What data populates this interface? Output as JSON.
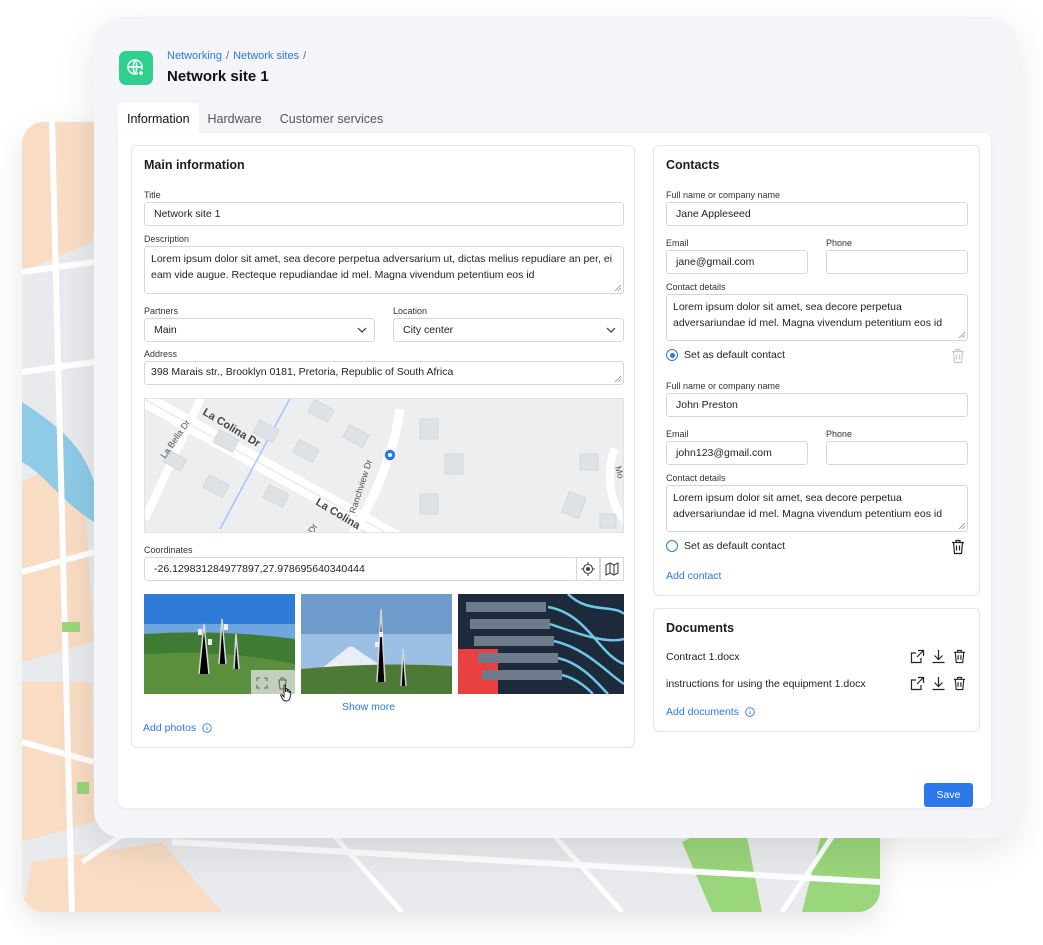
{
  "breadcrumb": {
    "item1": "Networking",
    "item2": "Network sites",
    "sep": "/"
  },
  "page_title": "Network site 1",
  "tabs": [
    "Information",
    "Hardware",
    "Customer services"
  ],
  "main_info": {
    "heading": "Main information",
    "title_label": "Title",
    "title_value": "Network site 1",
    "description_label": "Description",
    "description_value": "Lorem ipsum dolor sit amet, sea decore perpetua adversarium ut, dictas melius repudiare an per, ei eam vide augue. Recteque repudiandae id mel. Magna vivendum petentium eos id",
    "partners_label": "Partners",
    "partners_value": "Main",
    "location_label": "Location",
    "location_value": "City center",
    "address_label": "Address",
    "address_value": "398 Marais str., Brooklyn 0181, Pretoria, Republic of South Africa",
    "map_streets": [
      "La Colina Dr",
      "La Bella Dr",
      "Ranchview Dr",
      "La Colina",
      "Dr",
      "Mo"
    ],
    "coordinates_label": "Coordinates",
    "coordinates_value": "-26.129831284977897,27.978695640340444",
    "show_more": "Show more",
    "add_photos": "Add photos"
  },
  "contacts": {
    "heading": "Contacts",
    "name_label": "Full name or company name",
    "email_label": "Email",
    "phone_label": "Phone",
    "details_label": "Contact details",
    "default_label": "Set as default contact",
    "items": [
      {
        "name": "Jane Appleseed",
        "email": "jane@gmail.com",
        "phone": "",
        "details": "Lorem ipsum dolor sit amet, sea decore perpetua adversariundae id mel. Magna vivendum petentium eos id",
        "is_default": true
      },
      {
        "name": "John Preston",
        "email": "john123@gmail.com",
        "phone": "",
        "details": "Lorem ipsum dolor sit amet, sea decore perpetua adversariundae id mel. Magna vivendum petentium eos id",
        "is_default": false
      }
    ],
    "add_contact": "Add contact"
  },
  "documents": {
    "heading": "Documents",
    "files": [
      "Contract 1.docx",
      "instructions for using the equipment 1.docx"
    ],
    "add_documents": "Add documents"
  },
  "save_label": "Save",
  "colors": {
    "accent": "#2a78ea",
    "app_icon": "#2fcf8e",
    "map_pin": "#2a78ea"
  },
  "icons": [
    "globe-icon",
    "chevron-down-icon",
    "locate-icon",
    "map-icon",
    "info-icon",
    "trash-icon",
    "open-external-icon",
    "download-icon",
    "expand-icon"
  ]
}
